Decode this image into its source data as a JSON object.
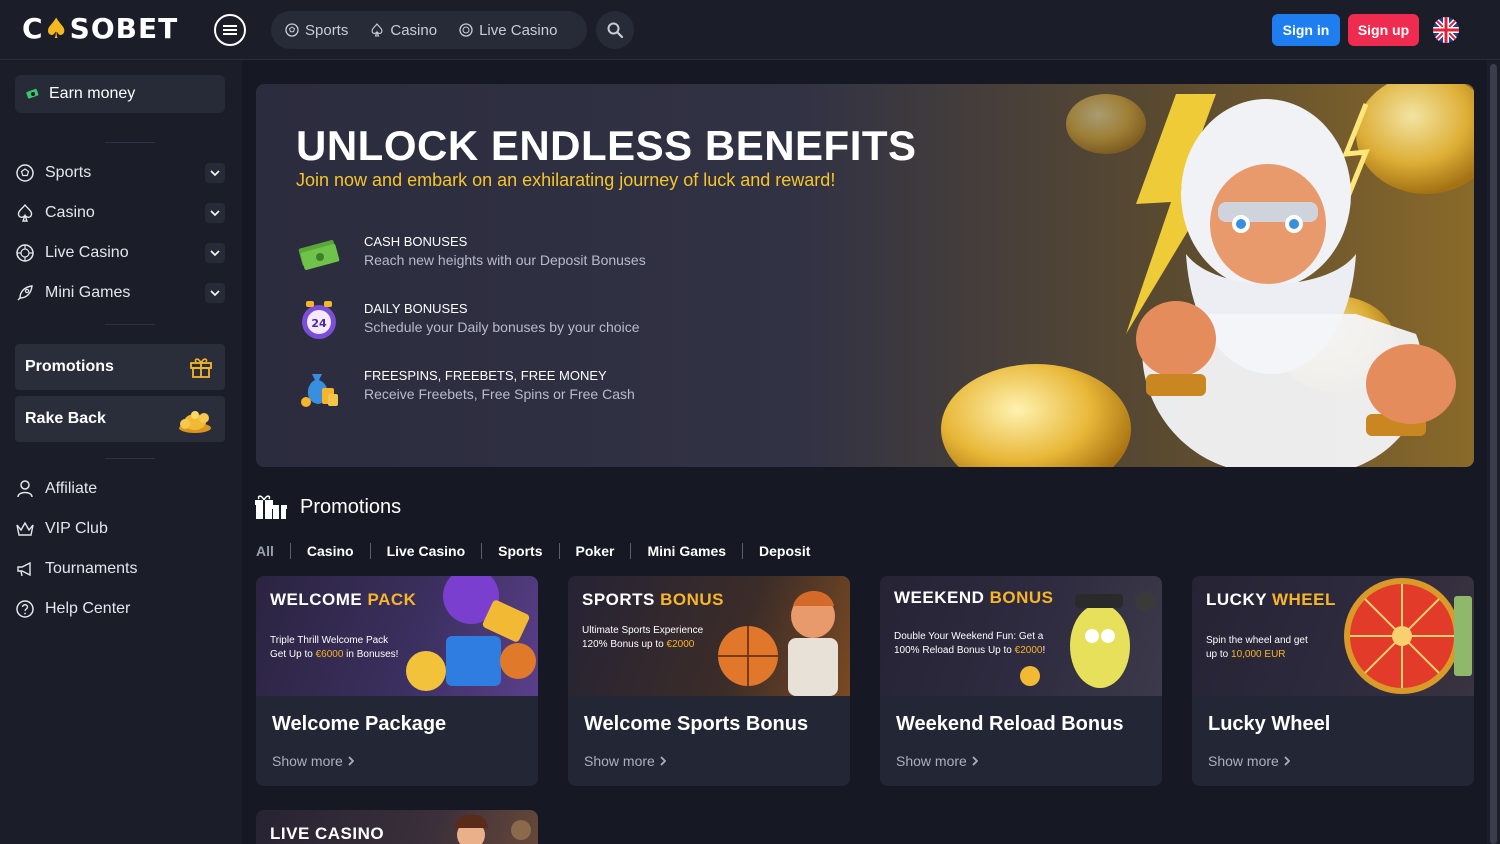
{
  "header": {
    "logo_text_a": "C",
    "logo_text_b": "SOBET",
    "nav": [
      {
        "label": "Sports",
        "icon": "soccer-ball-icon"
      },
      {
        "label": "Casino",
        "icon": "spade-icon"
      },
      {
        "label": "Live Casino",
        "icon": "chip-icon"
      }
    ],
    "signin_label": "Sign in",
    "signup_label": "Sign up",
    "language_flag": "uk-flag-icon"
  },
  "sidebar": {
    "earn_label": "Earn money",
    "main_items": [
      {
        "label": "Sports",
        "icon": "soccer-ball-icon"
      },
      {
        "label": "Casino",
        "icon": "spade-icon"
      },
      {
        "label": "Live Casino",
        "icon": "chip-icon"
      },
      {
        "label": "Mini Games",
        "icon": "rocket-icon"
      }
    ],
    "promotions_label": "Promotions",
    "rakeback_label": "Rake Back",
    "bottom_items": [
      {
        "label": "Affiliate",
        "icon": "users-icon"
      },
      {
        "label": "VIP Club",
        "icon": "crown-icon"
      },
      {
        "label": "Tournaments",
        "icon": "megaphone-icon"
      },
      {
        "label": "Help Center",
        "icon": "help-icon"
      }
    ]
  },
  "banner": {
    "title": "UNLOCK ENDLESS BENEFITS",
    "subtitle": "Join now and embark on an exhilarating journey of luck and reward!",
    "benefits": [
      {
        "title": "CASH BONUSES",
        "desc": "Reach new heights with our Deposit Bonuses",
        "icon": "cash-stack-icon"
      },
      {
        "title": "DAILY BONUSES",
        "desc": "Schedule your Daily bonuses by your choice",
        "icon": "clock-24-icon"
      },
      {
        "title": "FREESPINS, FREEBETS, FREE MONEY",
        "desc": "Receive Freebets, Free Spins or Free Cash",
        "icon": "money-bag-icon"
      }
    ]
  },
  "promotions": {
    "title": "Promotions",
    "filters": [
      "All",
      "Casino",
      "Live Casino",
      "Sports",
      "Poker",
      "Mini Games",
      "Deposit"
    ],
    "cards": [
      {
        "img_head_a": "WELCOME ",
        "img_head_b": "PACK",
        "img_line1": "Triple Thrill Welcome Pack",
        "img_line2_a": "Get Up to ",
        "img_line2_b": "€6000",
        "img_line2_c": " in Bonuses!",
        "title": "Welcome Package",
        "show_more": "Show more"
      },
      {
        "img_head_a": "SPORTS ",
        "img_head_b": "BONUS",
        "img_line1": "Ultimate Sports Experience",
        "img_line2_a": "120% Bonus up to ",
        "img_line2_b": "€2000",
        "img_line2_c": "",
        "title": "Welcome Sports Bonus",
        "show_more": "Show more"
      },
      {
        "img_head_a": "WEEKEND ",
        "img_head_b": "BONUS",
        "img_line1": "Double Your Weekend Fun: Get a",
        "img_line2_a": "100% Reload Bonus Up to ",
        "img_line2_b": "€2000",
        "img_line2_c": "!",
        "title": "Weekend Reload Bonus",
        "show_more": "Show more"
      },
      {
        "img_head_a": "LUCKY ",
        "img_head_b": "WHEEL",
        "img_line1": "Spin the wheel and get",
        "img_line2_a": "up to ",
        "img_line2_b": "10,000 EUR",
        "img_line2_c": "",
        "title": "Lucky Wheel",
        "show_more": "Show more"
      }
    ],
    "partial_card_head": "LIVE CASINO"
  },
  "colors": {
    "accent_gold": "#f7b52a",
    "signin_blue": "#1e7ef0",
    "signup_red": "#ef2b4f",
    "background": "#161923",
    "panel": "#1b1e29"
  }
}
